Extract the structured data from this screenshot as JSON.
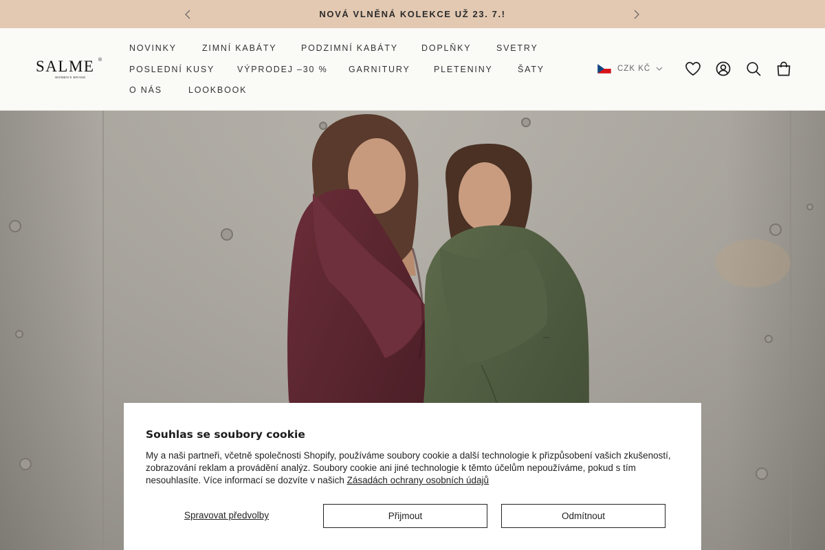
{
  "announcement": {
    "text": "NOVÁ VLNĚNÁ KOLEKCE UŽ 23. 7.!",
    "prev_icon": "chevron-left-icon",
    "next_icon": "chevron-right-icon"
  },
  "header": {
    "logo": {
      "name": "SALME",
      "mark": "®",
      "tagline": "WOMEN'S BRAND"
    },
    "nav": [
      "NOVINKY",
      "ZIMNÍ KABÁTY",
      "PODZIMNÍ KABÁTY",
      "DOPLŇKY",
      "SVETRY",
      "POSLEDNÍ KUSY",
      "VÝPRODEJ –30 %",
      "GARNITURY",
      "PLETENINY",
      "ŠATY",
      "O NÁS",
      "LOOKBOOK"
    ],
    "currency": {
      "flag_icon": "czech-flag-icon",
      "label": "CZK KČ",
      "chevron_icon": "chevron-down-icon"
    },
    "icons": [
      "heart-icon",
      "account-icon",
      "search-icon",
      "bag-icon"
    ]
  },
  "cookie_banner": {
    "title": "Souhlas se soubory cookie",
    "body": "My a naši partneři, včetně společnosti Shopify, používáme soubory cookie a další technologie k přizpůsobení vašich zkušeností, zobrazování reklam a provádění analýz. Soubory cookie ani jiné technologie k těmto účelům nepoužíváme, pokud s tím nesouhlasíte. Více informací se dozvíte v našich ",
    "policy_link": "Zásadách ochrany osobních údajů",
    "manage_label": "Spravovat předvolby",
    "accept_label": "Přijmout",
    "decline_label": "Odmítnout"
  },
  "colors": {
    "announcement_bg": "#e3c9b2",
    "header_bg": "#fafaf7",
    "text": "#1c1c1c",
    "burgundy_coat": "#5a2630",
    "olive_coat": "#4e5a3f",
    "concrete": "#a9a59d"
  }
}
